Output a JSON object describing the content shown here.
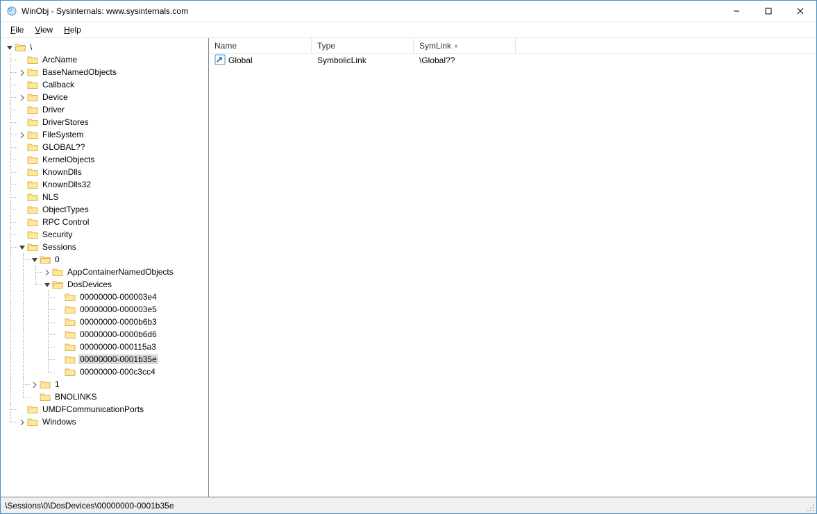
{
  "window": {
    "title": "WinObj - Sysinternals: www.sysinternals.com"
  },
  "menubar": {
    "file": "File",
    "view": "View",
    "help": "Help"
  },
  "tree": {
    "root_label": "\\",
    "nodes": [
      {
        "label": "ArcName",
        "depth": 1,
        "expander": "none",
        "last": false
      },
      {
        "label": "BaseNamedObjects",
        "depth": 1,
        "expander": "closed",
        "last": false
      },
      {
        "label": "Callback",
        "depth": 1,
        "expander": "none",
        "last": false
      },
      {
        "label": "Device",
        "depth": 1,
        "expander": "closed",
        "last": false
      },
      {
        "label": "Driver",
        "depth": 1,
        "expander": "none",
        "last": false
      },
      {
        "label": "DriverStores",
        "depth": 1,
        "expander": "none",
        "last": false
      },
      {
        "label": "FileSystem",
        "depth": 1,
        "expander": "closed",
        "last": false
      },
      {
        "label": "GLOBAL??",
        "depth": 1,
        "expander": "none",
        "last": false
      },
      {
        "label": "KernelObjects",
        "depth": 1,
        "expander": "none",
        "last": false
      },
      {
        "label": "KnownDlls",
        "depth": 1,
        "expander": "none",
        "last": false
      },
      {
        "label": "KnownDlls32",
        "depth": 1,
        "expander": "none",
        "last": false
      },
      {
        "label": "NLS",
        "depth": 1,
        "expander": "none",
        "last": false
      },
      {
        "label": "ObjectTypes",
        "depth": 1,
        "expander": "none",
        "last": false
      },
      {
        "label": "RPC Control",
        "depth": 1,
        "expander": "none",
        "last": false
      },
      {
        "label": "Security",
        "depth": 1,
        "expander": "none",
        "last": false
      },
      {
        "label": "Sessions",
        "depth": 1,
        "expander": "open",
        "last": false
      },
      {
        "label": "0",
        "depth": 2,
        "expander": "open",
        "last": false,
        "ancestors_are_last": [
          false
        ]
      },
      {
        "label": "AppContainerNamedObjects",
        "depth": 3,
        "expander": "closed",
        "last": false,
        "ancestors_are_last": [
          false,
          false
        ]
      },
      {
        "label": "DosDevices",
        "depth": 3,
        "expander": "open",
        "last": true,
        "ancestors_are_last": [
          false,
          false
        ]
      },
      {
        "label": "00000000-000003e4",
        "depth": 4,
        "expander": "none",
        "last": false,
        "ancestors_are_last": [
          false,
          false,
          true
        ]
      },
      {
        "label": "00000000-000003e5",
        "depth": 4,
        "expander": "none",
        "last": false,
        "ancestors_are_last": [
          false,
          false,
          true
        ]
      },
      {
        "label": "00000000-0000b6b3",
        "depth": 4,
        "expander": "none",
        "last": false,
        "ancestors_are_last": [
          false,
          false,
          true
        ]
      },
      {
        "label": "00000000-0000b6d6",
        "depth": 4,
        "expander": "none",
        "last": false,
        "ancestors_are_last": [
          false,
          false,
          true
        ]
      },
      {
        "label": "00000000-000115a3",
        "depth": 4,
        "expander": "none",
        "last": false,
        "ancestors_are_last": [
          false,
          false,
          true
        ]
      },
      {
        "label": "00000000-0001b35e",
        "depth": 4,
        "expander": "none",
        "last": false,
        "selected": true,
        "ancestors_are_last": [
          false,
          false,
          true
        ]
      },
      {
        "label": "00000000-000c3cc4",
        "depth": 4,
        "expander": "none",
        "last": true,
        "ancestors_are_last": [
          false,
          false,
          true
        ]
      },
      {
        "label": "1",
        "depth": 2,
        "expander": "closed",
        "last": false,
        "ancestors_are_last": [
          false
        ]
      },
      {
        "label": "BNOLINKS",
        "depth": 2,
        "expander": "none",
        "last": true,
        "ancestors_are_last": [
          false
        ]
      },
      {
        "label": "UMDFCommunicationPorts",
        "depth": 1,
        "expander": "none",
        "last": false
      },
      {
        "label": "Windows",
        "depth": 1,
        "expander": "closed",
        "last": true
      }
    ]
  },
  "list": {
    "columns": {
      "name": "Name",
      "type": "Type",
      "symlink": "SymLink"
    },
    "rows": [
      {
        "name": "Global",
        "type": "SymbolicLink",
        "symlink": "\\Global??"
      }
    ]
  },
  "statusbar": {
    "path": "\\Sessions\\0\\DosDevices\\00000000-0001b35e"
  }
}
